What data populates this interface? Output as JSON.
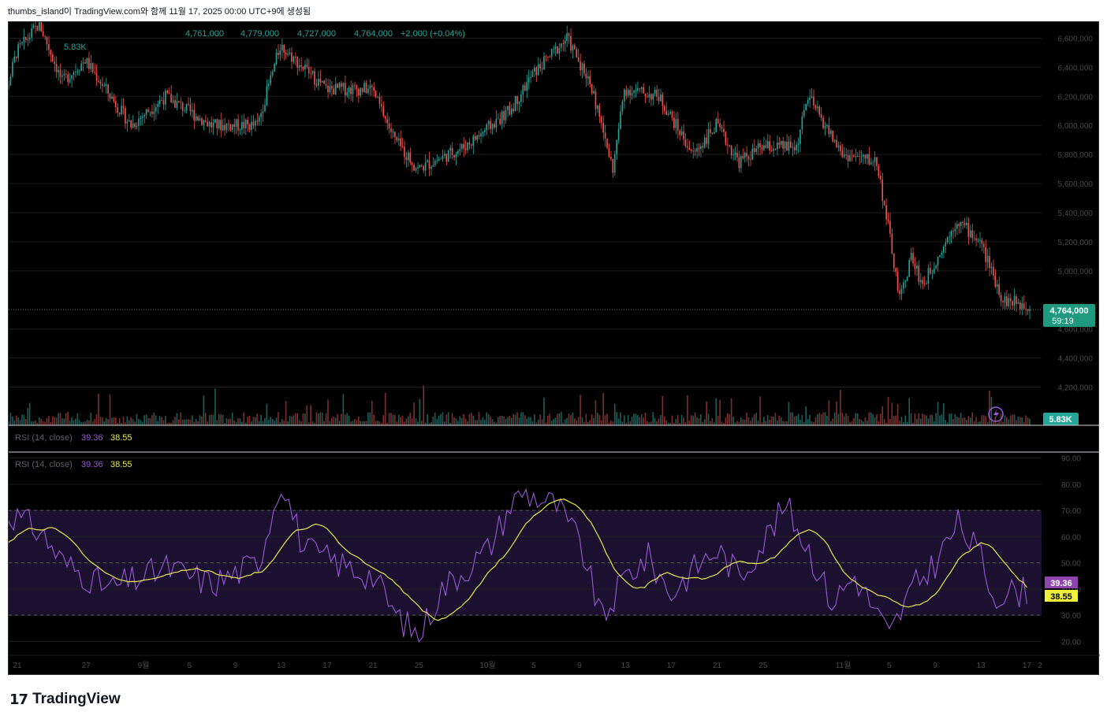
{
  "header": {
    "caption": "thumbs_island이 TradingView.com와 함께 11월 17, 2025 00:00 UTC+9에 생성됨"
  },
  "footer": {
    "brand": "TradingView"
  },
  "colors": {
    "up": "#26a69a",
    "down": "#ef5350",
    "rsi": "#9b59d6",
    "rsi_ma": "#e8e84a",
    "last_price_bg": "#1f9a7e",
    "grid": "#1f1f1f"
  },
  "main_pane": {
    "ohlc_open": "4,761,000",
    "ohlc_high": "4,779,000",
    "ohlc_low": "4,727,000",
    "ohlc_close": "4,764,000",
    "ohlc_change": "+2,000 (+0.04%)",
    "volume_label": "5.83K",
    "price_ticks": [
      "6,600,000",
      "6,400,000",
      "6,200,000",
      "6,000,000",
      "5,800,000",
      "5,600,000",
      "5,400,000",
      "5,200,000",
      "5,000,000",
      "4,600,000",
      "4,400,000",
      "4,200,000"
    ],
    "last_price": "4,764,000",
    "countdown": "59:19",
    "volume_badge": "5.83K"
  },
  "rsi_pane": {
    "legend_name": "RSI (14, close)",
    "rsi_value": "39.36",
    "ma_value": "38.55",
    "ticks": [
      "90.00",
      "80.00",
      "70.00",
      "60.00",
      "50.00",
      "40.00",
      "30.00",
      "20.00"
    ],
    "badge_rsi": "39.36",
    "badge_ma": "38.55"
  },
  "x_axis": {
    "ticks": [
      "21",
      "27",
      "9월",
      "5",
      "9",
      "13",
      "17",
      "21",
      "25",
      "10월",
      "5",
      "9",
      "13",
      "17",
      "21",
      "25",
      "11월",
      "5",
      "9",
      "13",
      "17",
      "2"
    ]
  },
  "chart_data": {
    "type": "candlestick",
    "price_axis": {
      "min": 4100000,
      "max": 6700000
    },
    "price_anchors": [
      [
        "Aug 19",
        5900000
      ],
      [
        "Aug 21",
        6500000
      ],
      [
        "Aug 23",
        6700000
      ],
      [
        "Aug 25",
        6300000
      ],
      [
        "Aug 27",
        6450000
      ],
      [
        "Aug 31",
        6000000
      ],
      [
        "Sep 3",
        6200000
      ],
      [
        "Sep 7",
        6000000
      ],
      [
        "Sep 11",
        6000000
      ],
      [
        "Sep 13",
        6550000
      ],
      [
        "Sep 17",
        6250000
      ],
      [
        "Sep 21",
        6250000
      ],
      [
        "Sep 23",
        5900000
      ],
      [
        "Sep 25",
        5700000
      ],
      [
        "Sep 29",
        5850000
      ],
      [
        "Oct 3",
        6100000
      ],
      [
        "Oct 5",
        6350000
      ],
      [
        "Oct 8",
        6600000
      ],
      [
        "Oct 10",
        6300000
      ],
      [
        "Oct 12",
        5700000
      ],
      [
        "Oct 13",
        6250000
      ],
      [
        "Oct 16",
        6200000
      ],
      [
        "Oct 19",
        5800000
      ],
      [
        "Oct 21",
        6000000
      ],
      [
        "Oct 23",
        5750000
      ],
      [
        "Oct 25",
        5850000
      ],
      [
        "Oct 28",
        5850000
      ],
      [
        "Oct 29",
        6200000
      ],
      [
        "Nov 1",
        5800000
      ],
      [
        "Nov 4",
        5750000
      ],
      [
        "Nov 5",
        5300000
      ],
      [
        "Nov 6",
        4800000
      ],
      [
        "Nov 7",
        5100000
      ],
      [
        "Nov 8",
        4900000
      ],
      [
        "Nov 10",
        5200000
      ],
      [
        "Nov 11",
        5350000
      ],
      [
        "Nov 13",
        5200000
      ],
      [
        "Nov 14",
        5000000
      ],
      [
        "Nov 15",
        4800000
      ],
      [
        "Nov 17",
        4764000
      ]
    ],
    "rsi_axis": {
      "min": 15,
      "max": 92
    },
    "rsi_anchors": [
      [
        "Aug 19",
        45
      ],
      [
        "Aug 20",
        70
      ],
      [
        "Aug 23",
        62
      ],
      [
        "Aug 25",
        50
      ],
      [
        "Aug 29",
        40
      ],
      [
        "Sep 3",
        48
      ],
      [
        "Sep 7",
        42
      ],
      [
        "Sep 11",
        50
      ],
      [
        "Sep 13",
        82
      ],
      [
        "Sep 15",
        55
      ],
      [
        "Sep 19",
        48
      ],
      [
        "Sep 21",
        45
      ],
      [
        "Sep 23",
        30
      ],
      [
        "Sep 25",
        22
      ],
      [
        "Sep 27",
        40
      ],
      [
        "Oct 1",
        55
      ],
      [
        "Oct 3",
        72
      ],
      [
        "Oct 4",
        77
      ],
      [
        "Oct 7",
        72
      ],
      [
        "Oct 9",
        58
      ],
      [
        "Oct 11",
        28
      ],
      [
        "Oct 13",
        45
      ],
      [
        "Oct 15",
        52
      ],
      [
        "Oct 17",
        38
      ],
      [
        "Oct 19",
        48
      ],
      [
        "Oct 21",
        55
      ],
      [
        "Oct 23",
        45
      ],
      [
        "Oct 25",
        58
      ],
      [
        "Oct 27",
        72
      ],
      [
        "Oct 29",
        55
      ],
      [
        "Oct 31",
        35
      ],
      [
        "Nov 2",
        45
      ],
      [
        "Nov 4",
        30
      ],
      [
        "Nov 5",
        22
      ],
      [
        "Nov 7",
        40
      ],
      [
        "Nov 9",
        50
      ],
      [
        "Nov 11",
        65
      ],
      [
        "Nov 13",
        52
      ],
      [
        "Nov 14",
        38
      ],
      [
        "Nov 17",
        39.36
      ]
    ],
    "rsi_levels": [
      70,
      50,
      30
    ],
    "volume_last": "5.83K"
  }
}
